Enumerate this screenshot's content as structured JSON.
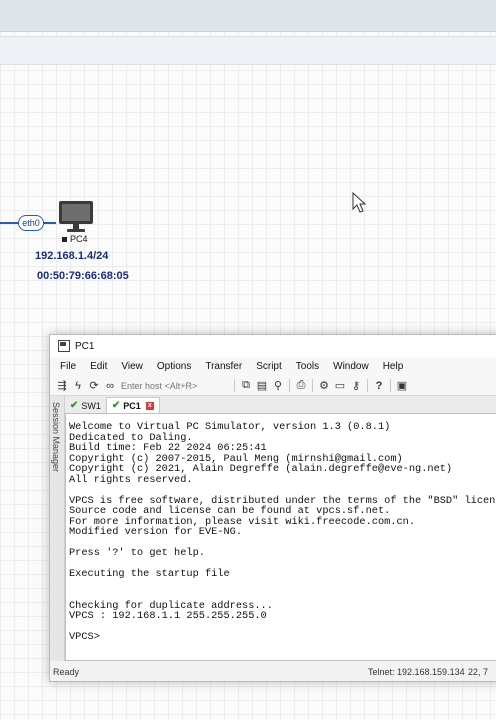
{
  "canvas": {
    "interface_label": "eth0",
    "node_name": "PC4",
    "node_ip": "192.168.1.4/24",
    "node_mac": "00:50:79:66:68:05"
  },
  "window": {
    "title": "PC1",
    "menu": [
      "File",
      "Edit",
      "View",
      "Options",
      "Transfer",
      "Script",
      "Tools",
      "Window",
      "Help"
    ],
    "host_placeholder": "Enter host <Alt+R>",
    "side_label": "Session Manager",
    "tabs": [
      {
        "label": "SW1",
        "connected": true
      },
      {
        "label": "PC1",
        "connected": true,
        "active": true
      }
    ],
    "terminal_text": "Welcome to Virtual PC Simulator, version 1.3 (0.8.1)\nDedicated to Daling.\nBuild time: Feb 22 2024 06:25:41\nCopyright (c) 2007-2015, Paul Meng (mirnshi@gmail.com)\nCopyright (c) 2021, Alain Degreffe (alain.degreffe@eve-ng.net)\nAll rights reserved.\n\nVPCS is free software, distributed under the terms of the \"BSD\" licence.\nSource code and license can be found at vpcs.sf.net.\nFor more information, please visit wiki.freecode.com.cn.\nModified version for EVE-NG.\n\nPress '?' to get help.\n\nExecuting the startup file\n\n\nChecking for duplicate address...\nVPCS : 192.168.1.1 255.255.255.0\n\nVPCS>",
    "status": {
      "ready": "Ready",
      "connection": "Telnet: 192.168.159.134",
      "position": "22,  7"
    }
  }
}
